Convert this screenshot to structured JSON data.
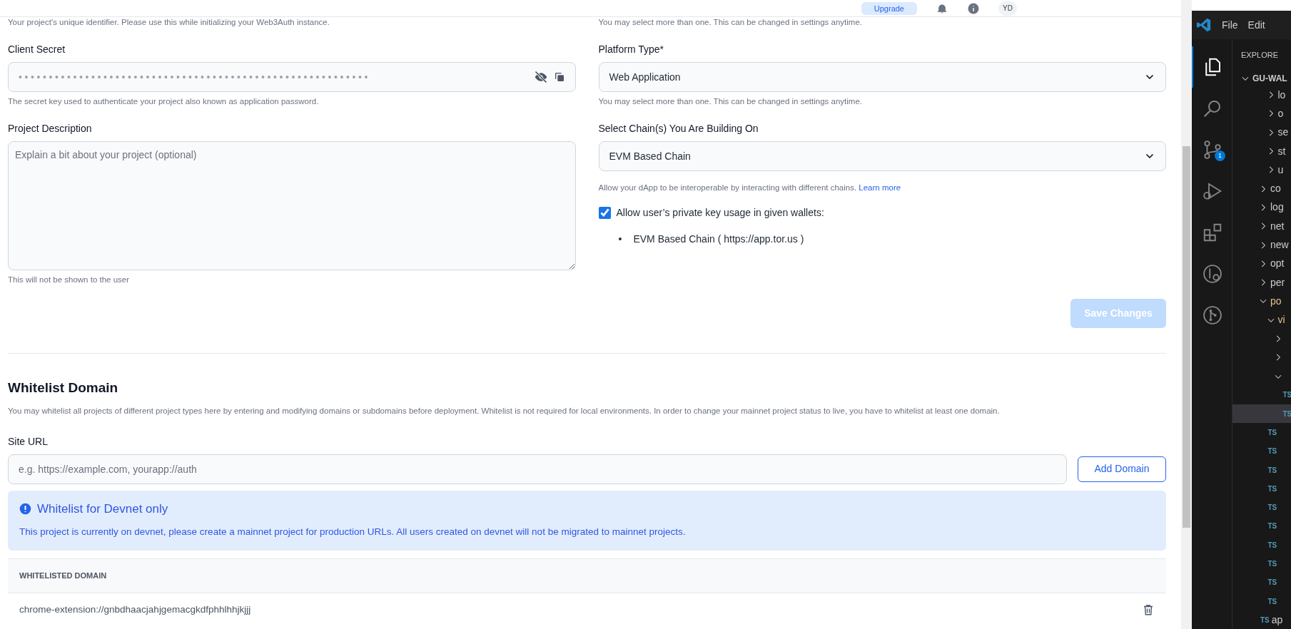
{
  "header": {
    "upgrade": "Upgrade",
    "avatar": "YD"
  },
  "left": {
    "top_hint": "Your project's unique identifier. Please use this while initializing your Web3Auth instance.",
    "client_secret": {
      "label": "Client Secret",
      "value": "••••••••••••••••••••••••••••••••••••••••••••••••••••••••••",
      "hint": "The secret key used to authenticate your project also known as application password."
    },
    "description": {
      "label": "Project Description",
      "placeholder": "Explain a bit about your project (optional)",
      "hint": "This will not be shown to the user"
    }
  },
  "right": {
    "top_hint": "You may select more than one. This can be changed in settings anytime.",
    "platform_type": {
      "label": "Platform Type*",
      "value": "Web Application",
      "hint": "You may select more than one. This can be changed in settings anytime."
    },
    "chains": {
      "label": "Select Chain(s) You Are Building On",
      "value": "EVM Based Chain",
      "hint": "Allow your dApp to be interoperable by interacting with different chains.",
      "link": "Learn more"
    },
    "private_key": {
      "checked": true,
      "label": "Allow user’s private key usage in given wallets:",
      "marker": "•",
      "items": [
        "EVM Based Chain ( https://app.tor.us )"
      ]
    }
  },
  "save_button": {
    "label": "Save Changes",
    "disabled": true
  },
  "whitelist": {
    "title": "Whitelist Domain",
    "description": "You may whitelist all projects of different project types here by entering and modifying domains or subdomains before deployment. Whitelist is not required for local environments. In order to change your mainnet project status to live, you have to whitelist at least one domain.",
    "site_url": {
      "label": "Site URL",
      "placeholder": "e.g. https://example.com, yourapp://auth"
    },
    "add_button": "Add Domain",
    "alert": {
      "title": "Whitelist for Devnet only",
      "body": "This project is currently on devnet, please create a mainnet project for production URLs. All users created on devnet will not be migrated to mainnet projects."
    },
    "table": {
      "columns": [
        "WHITELISTED DOMAIN"
      ],
      "rows": [
        {
          "domain": "chrome-extension://gnbdhaacjahjgemacgkdfphhlhhjkjjj"
        }
      ]
    }
  },
  "vscode": {
    "menu": [
      "File",
      "Edit"
    ],
    "activity": [
      {
        "kind": "files",
        "selected": true
      },
      {
        "kind": "search",
        "selected": false
      },
      {
        "kind": "scm",
        "selected": false,
        "badge": "1"
      },
      {
        "kind": "debug",
        "selected": false
      },
      {
        "kind": "extensions",
        "selected": false
      },
      {
        "kind": "remote",
        "selected": false
      },
      {
        "kind": "graph",
        "selected": false
      }
    ],
    "explorer_title": "EXPLORE",
    "root": {
      "kind": "folder",
      "label": "GU-WAL",
      "expanded": true,
      "children": [
        {
          "kind": "group",
          "children": [
            {
              "kind": "folder",
              "label": "lo",
              "expanded": false
            },
            {
              "kind": "folder",
              "label": "o",
              "expanded": false
            },
            {
              "kind": "folder",
              "label": "se",
              "expanded": false
            },
            {
              "kind": "folder",
              "label": "st",
              "expanded": false
            },
            {
              "kind": "folder",
              "label": "u",
              "expanded": false
            }
          ]
        },
        {
          "kind": "folder",
          "label": "co",
          "expanded": false
        },
        {
          "kind": "folder",
          "label": "log",
          "expanded": false
        },
        {
          "kind": "folder",
          "label": "net",
          "expanded": false
        },
        {
          "kind": "folder",
          "label": "new",
          "expanded": false
        },
        {
          "kind": "folder",
          "label": "opt",
          "expanded": false
        },
        {
          "kind": "folder",
          "label": "per",
          "expanded": false
        },
        {
          "kind": "folder",
          "label": "po",
          "expanded": true,
          "modified": true,
          "children": [
            {
              "kind": "folder",
              "label": "vi",
              "expanded": true,
              "modified": true,
              "children": [
                {
                  "kind": "folder",
                  "expanded": false
                },
                {
                  "kind": "folder",
                  "expanded": false
                },
                {
                  "kind": "folder",
                  "expanded": true,
                  "children": [
                    {
                      "kind": "file",
                      "badge": "TS",
                      "selected": false
                    },
                    {
                      "kind": "file",
                      "badge": "TS",
                      "selected": true
                    }
                  ]
                }
              ]
            },
            {
              "kind": "file",
              "badge": "TS",
              "selected": false
            },
            {
              "kind": "file",
              "badge": "TS",
              "selected": false
            },
            {
              "kind": "file",
              "badge": "TS",
              "selected": false
            },
            {
              "kind": "file",
              "badge": "TS",
              "selected": false
            },
            {
              "kind": "file",
              "badge": "TS",
              "selected": false
            },
            {
              "kind": "file",
              "badge": "TS",
              "selected": false
            },
            {
              "kind": "file",
              "badge": "TS",
              "selected": false
            },
            {
              "kind": "file",
              "badge": "TS",
              "selected": false
            },
            {
              "kind": "file",
              "badge": "TS",
              "selected": false
            },
            {
              "kind": "file",
              "badge": "TS",
              "selected": false
            }
          ]
        },
        {
          "kind": "file",
          "badge": "TS",
          "label": "ap",
          "selected": false
        }
      ]
    }
  }
}
